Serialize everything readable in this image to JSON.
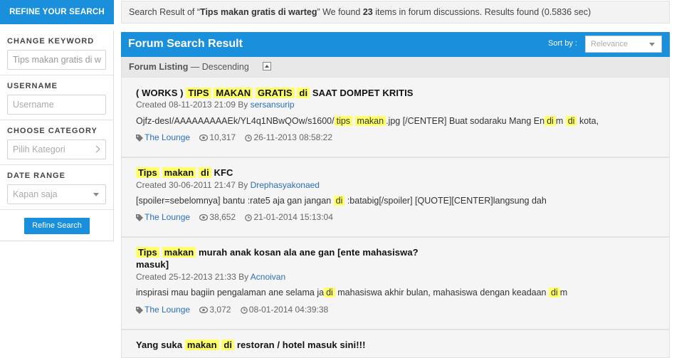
{
  "sidebar": {
    "header": "REFINE YOUR SEARCH",
    "keyword": {
      "label": "CHANGE KEYWORD",
      "value": "Tips makan gratis di w"
    },
    "username": {
      "label": "USERNAME",
      "placeholder": "Username"
    },
    "category": {
      "label": "CHOOSE CATEGORY",
      "value": "Pilih Kategori"
    },
    "date_range": {
      "label": "DATE RANGE",
      "value": "Kapan saja"
    },
    "button": "Refine Search"
  },
  "summary": {
    "prefix": "Search Result of “",
    "query": "Tips makan gratis di warteg",
    "middle": "” We found ",
    "count": "23",
    "suffix": " items in forum discussions. Results found (0.5836 sec)"
  },
  "forum": {
    "title": "Forum Search Result",
    "sort_label": "Sort by :",
    "sort_value": "Relevance",
    "listing_label": "Forum Listing",
    "listing_order": " — Descending"
  },
  "results": [
    {
      "title_parts": [
        {
          "t": "( WORKS ) ",
          "h": false
        },
        {
          "t": "TIPS",
          "h": true
        },
        {
          "t": " ",
          "h": false
        },
        {
          "t": "MAKAN",
          "h": true
        },
        {
          "t": " ",
          "h": false
        },
        {
          "t": "GRATIS",
          "h": true
        },
        {
          "t": " ",
          "h": false
        },
        {
          "t": "di",
          "h": true
        },
        {
          "t": " SAAT DOMPET KRITIS",
          "h": false
        }
      ],
      "created_prefix": "Created 08-11-2013 21:09 By ",
      "author": "sersansurip",
      "snippet_parts": [
        {
          "t": "Ojfz-desI/AAAAAAAAAEk/YL4q1NBwQOw/s1600/",
          "h": false
        },
        {
          "t": "tips",
          "h": true
        },
        {
          "t": " ",
          "h": false
        },
        {
          "t": "makan",
          "h": true
        },
        {
          "t": ".jpg [/CENTER] Buat sodaraku Mang En",
          "h": false
        },
        {
          "t": "di",
          "h": true
        },
        {
          "t": "m ",
          "h": false
        },
        {
          "t": "di",
          "h": true
        },
        {
          "t": " kota,",
          "h": false
        }
      ],
      "category": "The Lounge",
      "views": "10,317",
      "date": "26-11-2013 08:58:22"
    },
    {
      "title_parts": [
        {
          "t": "Tips",
          "h": true
        },
        {
          "t": " ",
          "h": false
        },
        {
          "t": "makan",
          "h": true
        },
        {
          "t": " ",
          "h": false
        },
        {
          "t": "di",
          "h": true
        },
        {
          "t": " KFC",
          "h": false
        }
      ],
      "created_prefix": "Created 30-06-2011 21:47 By ",
      "author": "Drephasyakonaed",
      "snippet_parts": [
        {
          "t": "[spoiler=sebelomnya] bantu :rate5 aja gan jangan ",
          "h": false
        },
        {
          "t": "di",
          "h": true
        },
        {
          "t": " :batabig[/spoiler] [QUOTE][CENTER]langsung dah",
          "h": false
        }
      ],
      "category": "The Lounge",
      "views": "38,652",
      "date": "21-01-2014 15:13:04"
    },
    {
      "title_parts": [
        {
          "t": "Tips",
          "h": true
        },
        {
          "t": " ",
          "h": false
        },
        {
          "t": "makan",
          "h": true
        },
        {
          "t": " murah anak kosan ala ane gan [ente mahasiswa?",
          "h": false
        },
        {
          "t": "\nmasuk]",
          "h": false
        }
      ],
      "created_prefix": "Created 25-12-2013 21:33 By ",
      "author": "Acnoivan",
      "snippet_parts": [
        {
          "t": "inspirasi mau bagiin pengalaman ane selama ja",
          "h": false
        },
        {
          "t": "di",
          "h": true
        },
        {
          "t": " mahasiswa akhir bulan, mahasiswa dengan keadaan ",
          "h": false
        },
        {
          "t": "di",
          "h": true
        },
        {
          "t": "m",
          "h": false
        }
      ],
      "category": "The Lounge",
      "views": "3,072",
      "date": "08-01-2014 04:39:38"
    },
    {
      "title_parts": [
        {
          "t": "Yang suka ",
          "h": false
        },
        {
          "t": "makan",
          "h": true
        },
        {
          "t": " ",
          "h": false
        },
        {
          "t": "di",
          "h": true
        },
        {
          "t": " restoran / hotel masuk sini!!!",
          "h": false
        }
      ]
    }
  ]
}
